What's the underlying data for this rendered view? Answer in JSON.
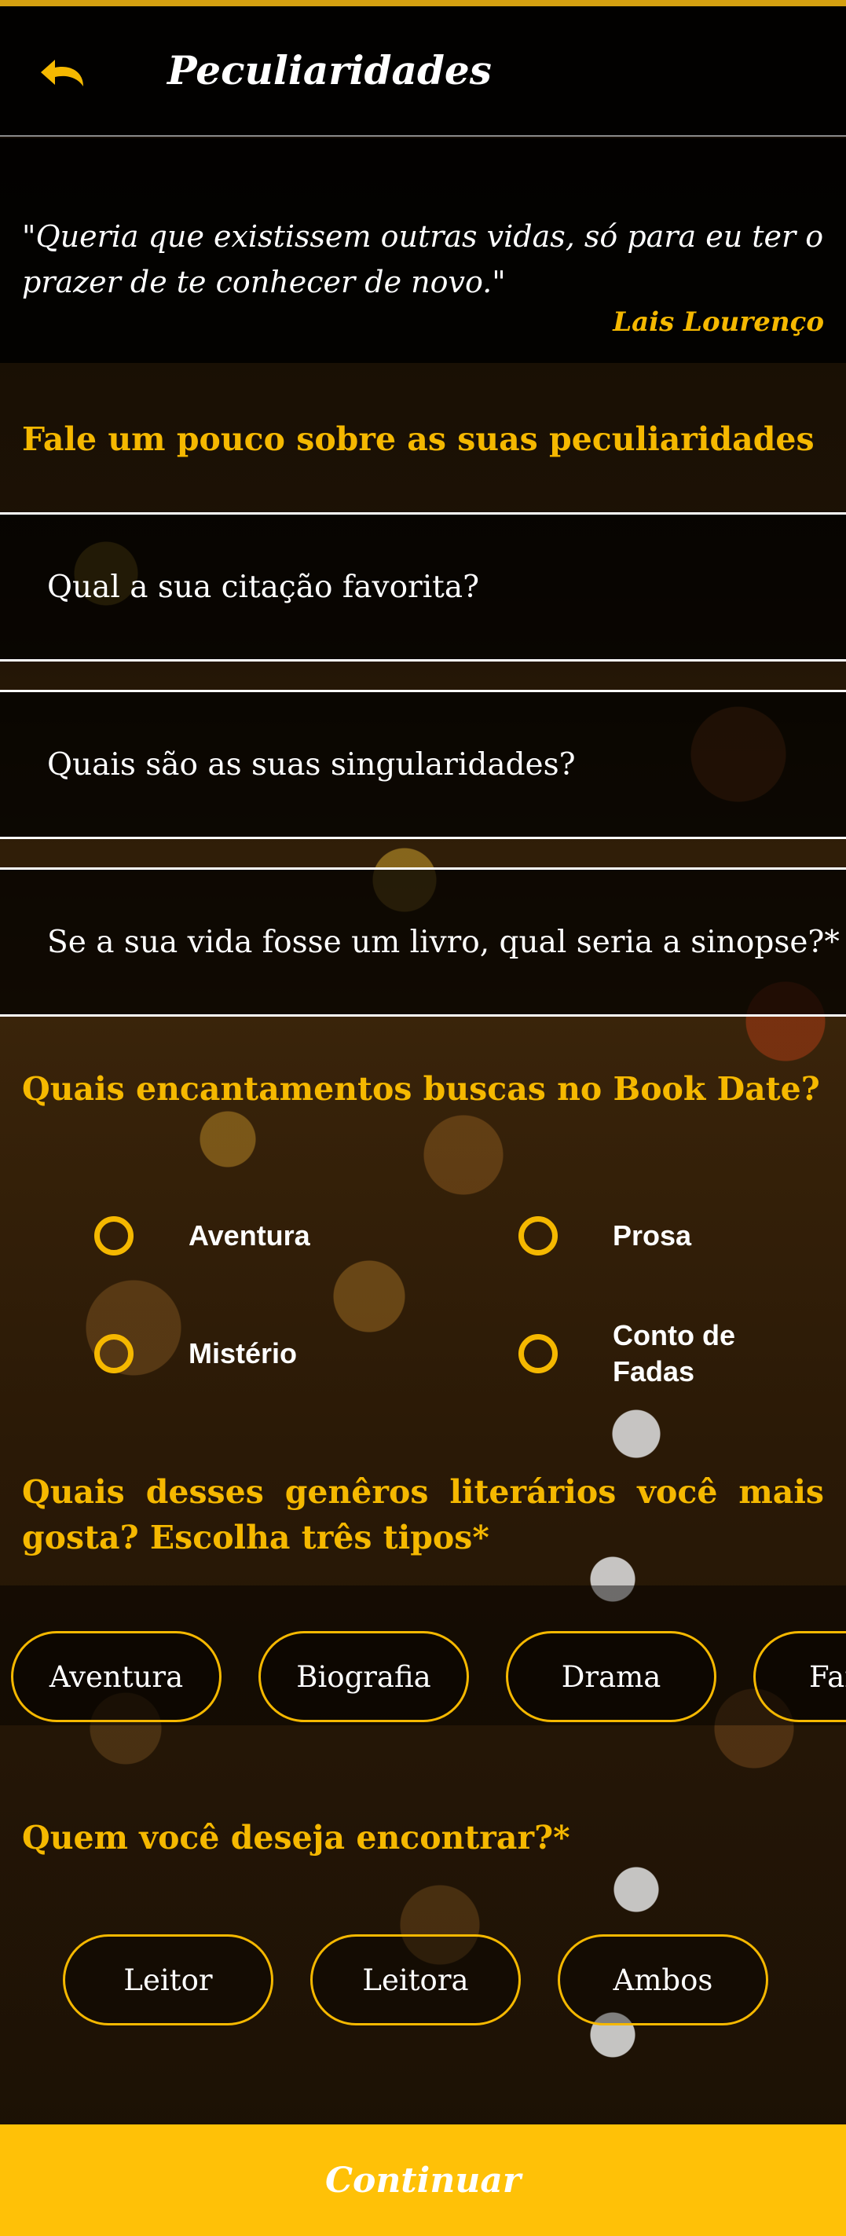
{
  "header": {
    "title": "Peculiaridades",
    "back_icon": "undo-arrow-icon"
  },
  "quote": {
    "text": "\"Queria que existissem outras vidas, só para eu ter o prazer de te conhecer de novo.\"",
    "author": "Lais Lourenço"
  },
  "section_peculiarities": {
    "title": "Fale um pouco sobre as suas peculiaridades",
    "fields": [
      {
        "placeholder": "Qual a sua citação favorita?"
      },
      {
        "placeholder": "Quais são as suas singularidades?"
      },
      {
        "placeholder": "Se a sua vida fosse um livro, qual seria a sinopse?*"
      }
    ]
  },
  "section_enchantments": {
    "title": "Quais encantamentos buscas no Book Date?",
    "options": [
      "Aventura",
      "Prosa",
      "Mistério",
      "Conto de Fadas"
    ]
  },
  "section_genres": {
    "title": "Quais desses genêros literários você mais gosta? Escolha três tipos*",
    "chips": [
      "Aventura",
      "Biografia",
      "Drama",
      "Fantasia"
    ]
  },
  "section_meet": {
    "title": "Quem você deseja encontrar?*",
    "chips": [
      "Leitor",
      "Leitora",
      "Ambos"
    ]
  },
  "footer": {
    "continue_label": "Continuar"
  },
  "colors": {
    "accent": "#f5b800",
    "button": "#ffc107",
    "top_bar": "#000000"
  }
}
